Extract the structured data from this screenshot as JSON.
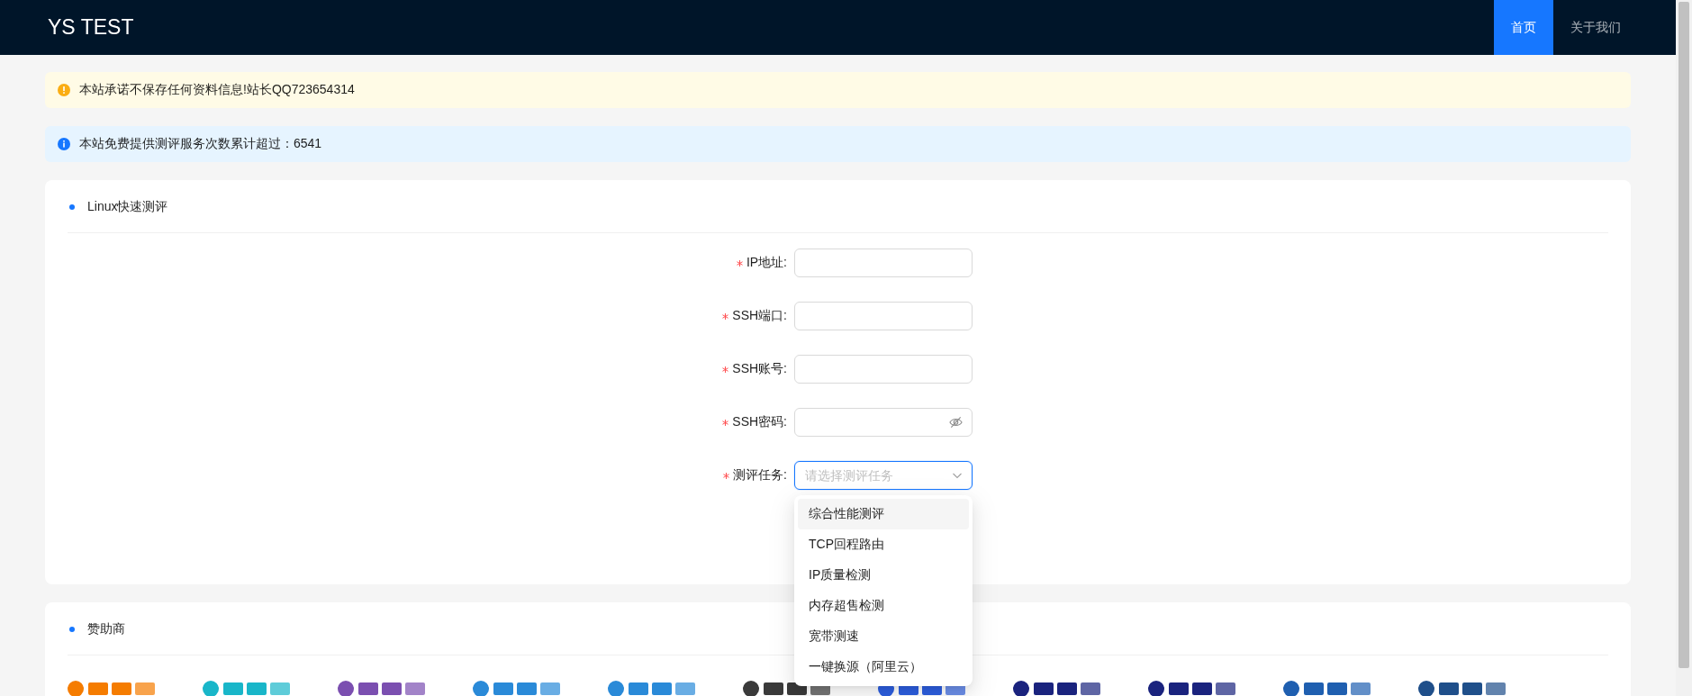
{
  "header": {
    "title": "YS TEST",
    "nav": [
      {
        "label": "首页",
        "selected": true
      },
      {
        "label": "关于我们",
        "selected": false
      }
    ]
  },
  "alerts": [
    {
      "kind": "warning",
      "text": "本站承诺不保存任何资料信息!站长QQ723654314"
    },
    {
      "kind": "info",
      "text": "本站免费提供测评服务次数累计超过：6541"
    }
  ],
  "form_card": {
    "title": "Linux快速测评",
    "fields": [
      {
        "kind": "text",
        "label": "IP地址:",
        "required": true
      },
      {
        "kind": "text",
        "label": "SSH端口:",
        "required": true
      },
      {
        "kind": "text",
        "label": "SSH账号:",
        "required": true
      },
      {
        "kind": "password",
        "label": "SSH密码:",
        "required": true
      },
      {
        "kind": "select",
        "label": "测评任务:",
        "required": true,
        "placeholder": "请选择测评任务",
        "expanded": true,
        "options": [
          {
            "label": "综合性能测评",
            "highlighted": true
          },
          {
            "label": "TCP回程路由",
            "highlighted": false
          },
          {
            "label": "IP质量检测",
            "highlighted": false
          },
          {
            "label": "内存超售检测",
            "highlighted": false
          },
          {
            "label": "宽带测速",
            "highlighted": false
          },
          {
            "label": "一键换源（阿里云）",
            "highlighted": false
          }
        ]
      }
    ]
  },
  "sponsor_card": {
    "title": "赞助商"
  }
}
